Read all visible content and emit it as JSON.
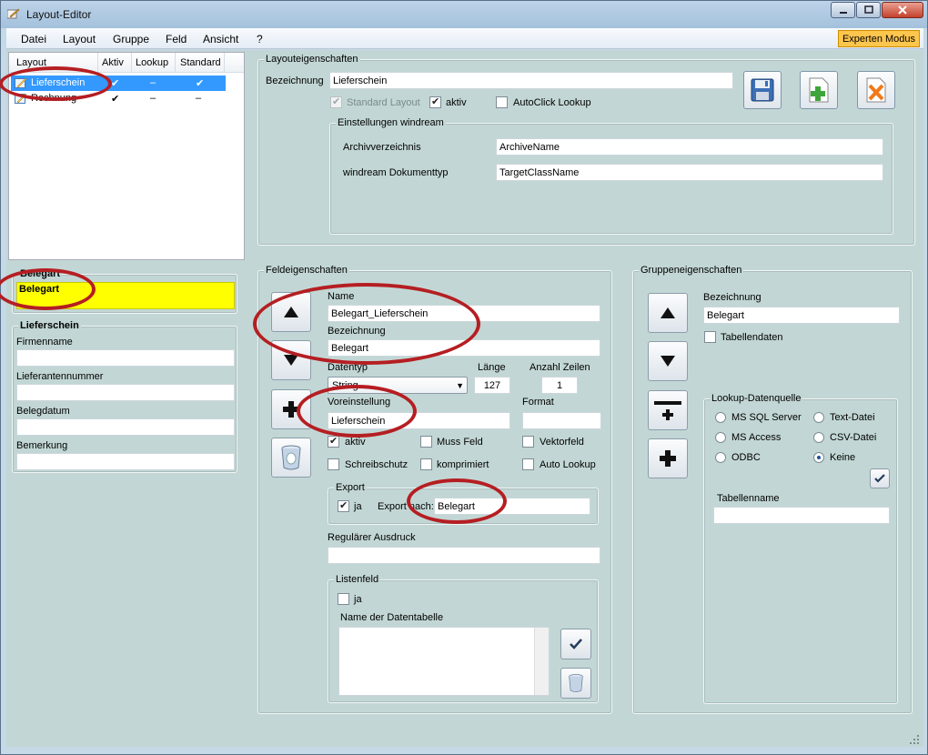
{
  "window": {
    "title": "Layout-Editor"
  },
  "menu": {
    "items": [
      "Datei",
      "Layout",
      "Gruppe",
      "Feld",
      "Ansicht",
      "?"
    ],
    "expert_button": "Experten Modus"
  },
  "layout_list": {
    "columns": [
      "Layout",
      "Aktiv",
      "Lookup",
      "Standard"
    ],
    "rows": [
      {
        "name": "Lieferschein",
        "aktiv": "✔",
        "lookup": "–",
        "standard": "✔"
      },
      {
        "name": "Rechnung",
        "aktiv": "✔",
        "lookup": "–",
        "standard": "–"
      }
    ]
  },
  "layout_props": {
    "legend": "Layouteigenschaften",
    "bezeichnung_label": "Bezeichnung",
    "bezeichnung_value": "Lieferschein",
    "standard_layout_label": "Standard Layout",
    "aktiv_label": "aktiv",
    "autoclick_label": "AutoClick Lookup",
    "windream": {
      "legend": "Einstellungen windream",
      "archiv_label": "Archivverzeichnis",
      "archiv_value": "ArchiveName",
      "doktyp_label": "windream Dokumenttyp",
      "doktyp_value": "TargetClassName"
    }
  },
  "preview": {
    "group1_title": "Belegart",
    "group1_field": "Belegart",
    "group2_title": "Lieferschein",
    "fields": [
      "Firmenname",
      "Lieferantennummer",
      "Belegdatum",
      "Bemerkung"
    ]
  },
  "field_props": {
    "legend": "Feldeigenschaften",
    "name_label": "Name",
    "name_value": "Belegart_Lieferschein",
    "bezeichnung_label": "Bezeichnung",
    "bezeichnung_value": "Belegart",
    "datentyp_label": "Datentyp",
    "datentyp_value": "String",
    "laenge_label": "Länge",
    "laenge_value": "127",
    "zeilen_label": "Anzahl Zeilen",
    "zeilen_value": "1",
    "voreinstellung_label": "Voreinstellung",
    "voreinstellung_value": "Lieferschein",
    "format_label": "Format",
    "format_value": "",
    "checks": {
      "aktiv": "aktiv",
      "muss": "Muss Feld",
      "vektor": "Vektorfeld",
      "schreibschutz": "Schreibschutz",
      "komprimiert": "komprimiert",
      "autolookup": "Auto Lookup"
    },
    "export": {
      "legend": "Export",
      "ja_label": "ja",
      "nach_label": "Export nach:",
      "nach_value": "Belegart"
    },
    "regex_label": "Regulärer Ausdruck",
    "regex_value": "",
    "listenfeld": {
      "legend": "Listenfeld",
      "ja_label": "ja",
      "table_label": "Name der Datentabelle"
    }
  },
  "group_props": {
    "legend": "Gruppeneigenschaften",
    "bezeichnung_label": "Bezeichnung",
    "bezeichnung_value": "Belegart",
    "tabellendaten_label": "Tabellendaten",
    "lookup": {
      "legend": "Lookup-Datenquelle",
      "options": [
        "MS SQL Server",
        "Text-Datei",
        "MS Access",
        "CSV-Datei",
        "ODBC",
        "Keine"
      ],
      "selected": "Keine",
      "tabellenname_label": "Tabellenname",
      "tabellenname_value": ""
    }
  },
  "colors": {
    "panel_bg": "#c2d7d5",
    "selection": "#3399ff",
    "highlight": "#ffff00",
    "annotation": "#b51e22",
    "expert": "#ffc64d"
  }
}
